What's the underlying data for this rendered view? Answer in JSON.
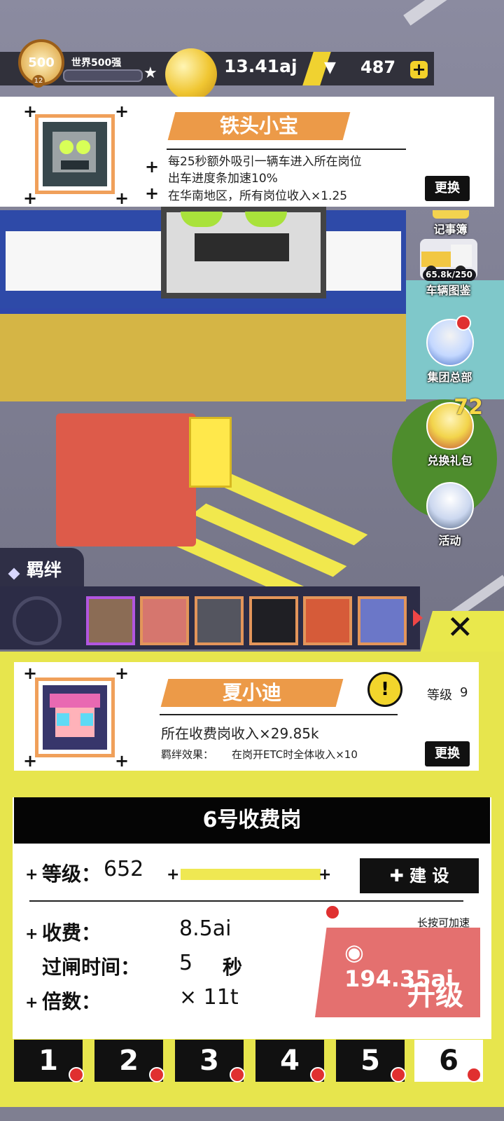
{
  "topbar": {
    "medal_value": "500",
    "medal_sub": "12",
    "rank_label": "世界500强",
    "coins": "13.41aj",
    "gems": "487",
    "icons": [
      "medal-icon",
      "star-icon",
      "coin-icon",
      "diamond-icon",
      "plus-icon"
    ]
  },
  "manager_card": {
    "name": "铁头小宝",
    "effects": [
      "每25秒额外吸引一辆车进入所在岗位",
      "出车进度条加速10%",
      "在华南地区，所有岗位收入×1.25"
    ],
    "swap_label": "更换"
  },
  "side_menu": {
    "notebook": "记事簿",
    "vehicle_guide": "车辆图鉴",
    "vehicle_count": "65.8k/250",
    "group_hq": "集团总部",
    "gift_exchange": "兑换礼包",
    "gift_badge": "72",
    "activity": "活动"
  },
  "bond": {
    "tab_label": "羁绊"
  },
  "keeper_card": {
    "name": "夏小迪",
    "level_label": "等级",
    "level": "9",
    "effect": "所在收费岗收入×29.85k",
    "bond_label": "羁绊效果：",
    "bond_effect": "在岗开ETC时全体收入×10",
    "swap_label": "更换"
  },
  "station": {
    "title": "6号收费岗",
    "level_label": "等级：",
    "level": "652",
    "build_label": "建 设",
    "hint": "长按可加速",
    "fee_label": "收费：",
    "fee": "8.5ai",
    "gate_time_label": "过闸时间：",
    "gate_time": "5",
    "gate_time_unit": "秒",
    "multiplier_label": "倍数：",
    "multiplier": "× 11t",
    "upgrade_cost": "◉ 194.35ai",
    "upgrade_label": "升级",
    "tabs": [
      "1",
      "2",
      "3",
      "4",
      "5",
      "6"
    ],
    "active_tab": "6"
  },
  "colors": {
    "panel_yellow": "#e7e54d",
    "ribbon_orange": "#ec9a48",
    "upgrade_red": "#e4706f",
    "dark": "#111111"
  }
}
